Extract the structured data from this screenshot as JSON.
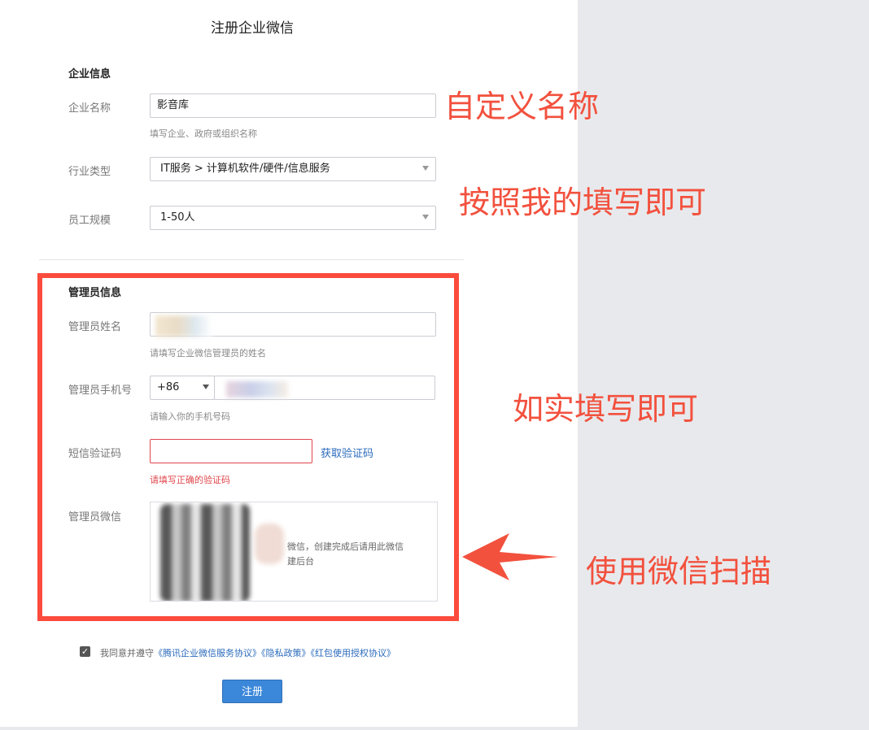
{
  "page": {
    "title": "注册企业微信"
  },
  "company_section": {
    "heading": "企业信息",
    "name_label": "企业名称",
    "name_value": "影音库",
    "name_hint": "填写企业、政府或组织名称",
    "industry_label": "行业类型",
    "industry_value": "IT服务 > 计算机软件/硬件/信息服务",
    "size_label": "员工规模",
    "size_value": "1-50人"
  },
  "admin_section": {
    "heading": "管理员信息",
    "name_label": "管理员姓名",
    "name_hint": "请填写企业微信管理员的姓名",
    "phone_label": "管理员手机号",
    "country_code": "+86",
    "phone_hint": "请输入你的手机号码",
    "sms_label": "短信验证码",
    "get_code_link": "获取验证码",
    "sms_error": "请填写正确的验证码",
    "wechat_label": "管理员微信",
    "qr_text_line1": "微信，创建完成后请用此微信",
    "qr_text_line2": "建后台"
  },
  "agreement": {
    "prefix": "我同意并遵守",
    "service": "《腾讯企业微信服务协议》",
    "privacy": "《隐私政策》",
    "redpacket": "《红包使用授权协议》",
    "checked": true
  },
  "submit": {
    "label": "注册"
  },
  "annotations": {
    "custom_name": "自定义名称",
    "fill_like_me": "按照我的填写即可",
    "fill_truthfully": "如实填写即可",
    "scan_wechat": "使用微信扫描",
    "color": "#f2513e"
  }
}
